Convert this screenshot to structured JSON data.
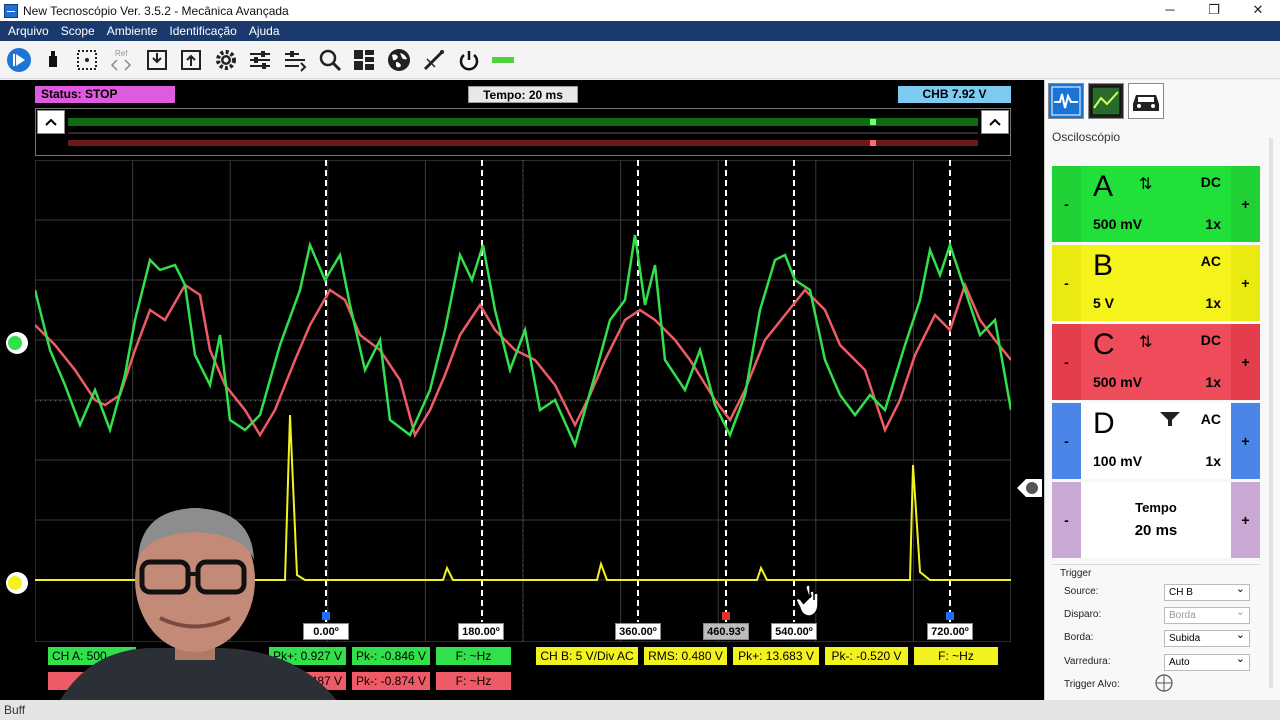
{
  "window": {
    "title": "New Tecnoscópio Ver. 3.5.2  - Mecânica Avançada"
  },
  "window_controls": {
    "minimize": "─",
    "restore": "❐",
    "close": "✕"
  },
  "menu": [
    "Arquivo",
    "Scope",
    "Ambiente",
    "Identificação",
    "Ajuda"
  ],
  "toolbar": {
    "ref_label": "Ref"
  },
  "scope": {
    "status": "Status: STOP",
    "time": "Tempo: 20 ms",
    "chb": "CHB 7.92 V",
    "degree_markers": [
      "0.00º",
      "180.00º",
      "360.00º",
      "460.93º",
      "540.00º",
      "720.00º"
    ]
  },
  "measurements": {
    "row1": [
      "CH A: 500",
      "Pk+: 0.927 V",
      "Pk-: -0.846 V",
      "F: ~Hz",
      "CH B: 5 V/Div AC",
      "RMS: 0.480 V",
      "Pk+: 13.683 V",
      "Pk-: -0.520 V",
      "F: ~Hz"
    ],
    "row2": [
      "487 V",
      "Pk-: -0.874 V",
      "F: ~Hz"
    ]
  },
  "panel": {
    "label": "Osciloscópio",
    "channels": [
      {
        "letter": "A",
        "coupling": "DC",
        "value": "500 mV",
        "mult": "1x",
        "minus": "-",
        "plus": "+",
        "color": "#22e03a",
        "side": "#1fd135"
      },
      {
        "letter": "B",
        "coupling": "AC",
        "value": "5 V",
        "mult": "1x",
        "minus": "-",
        "plus": "+",
        "color": "#f5f21c",
        "side": "#eaea10"
      },
      {
        "letter": "C",
        "coupling": "DC",
        "value": "500 mV",
        "mult": "1x",
        "minus": "-",
        "plus": "+",
        "color": "#ee4c5a",
        "side": "#e43d4c"
      },
      {
        "letter": "D",
        "coupling": "AC",
        "value": "100 mV",
        "mult": "1x",
        "minus": "-",
        "plus": "+",
        "color": "#ffffff",
        "side": "#4a86e8"
      }
    ],
    "tempo": {
      "label": "Tempo",
      "value": "20 ms",
      "minus": "-",
      "plus": "+"
    },
    "trigger": {
      "title": "Trigger",
      "fields": [
        {
          "label": "Source:",
          "value": "CH B"
        },
        {
          "label": "Disparo:",
          "value": "Borda"
        },
        {
          "label": "Borda:",
          "value": "Subida"
        },
        {
          "label": "Varredura:",
          "value": "Auto"
        }
      ],
      "alvo_label": "Trigger Alvo:"
    }
  },
  "status_bar": {
    "text": "Buff"
  },
  "colors": {
    "cha": "#31e04a",
    "chb": "#f2f21e",
    "chc": "#ee5b66",
    "status_bg": "#e05ae0",
    "chb_badge": "#7ecbf2"
  },
  "icons": [
    "play-icon",
    "usb-icon",
    "grid-icon",
    "ref-arrows-icon",
    "save-icon",
    "open-icon",
    "gear-icon",
    "sliders-icon",
    "sliders-arrow-icon",
    "zoom-icon",
    "layout-icon",
    "globe-icon",
    "probe-icon",
    "power-icon",
    "battery-icon"
  ]
}
